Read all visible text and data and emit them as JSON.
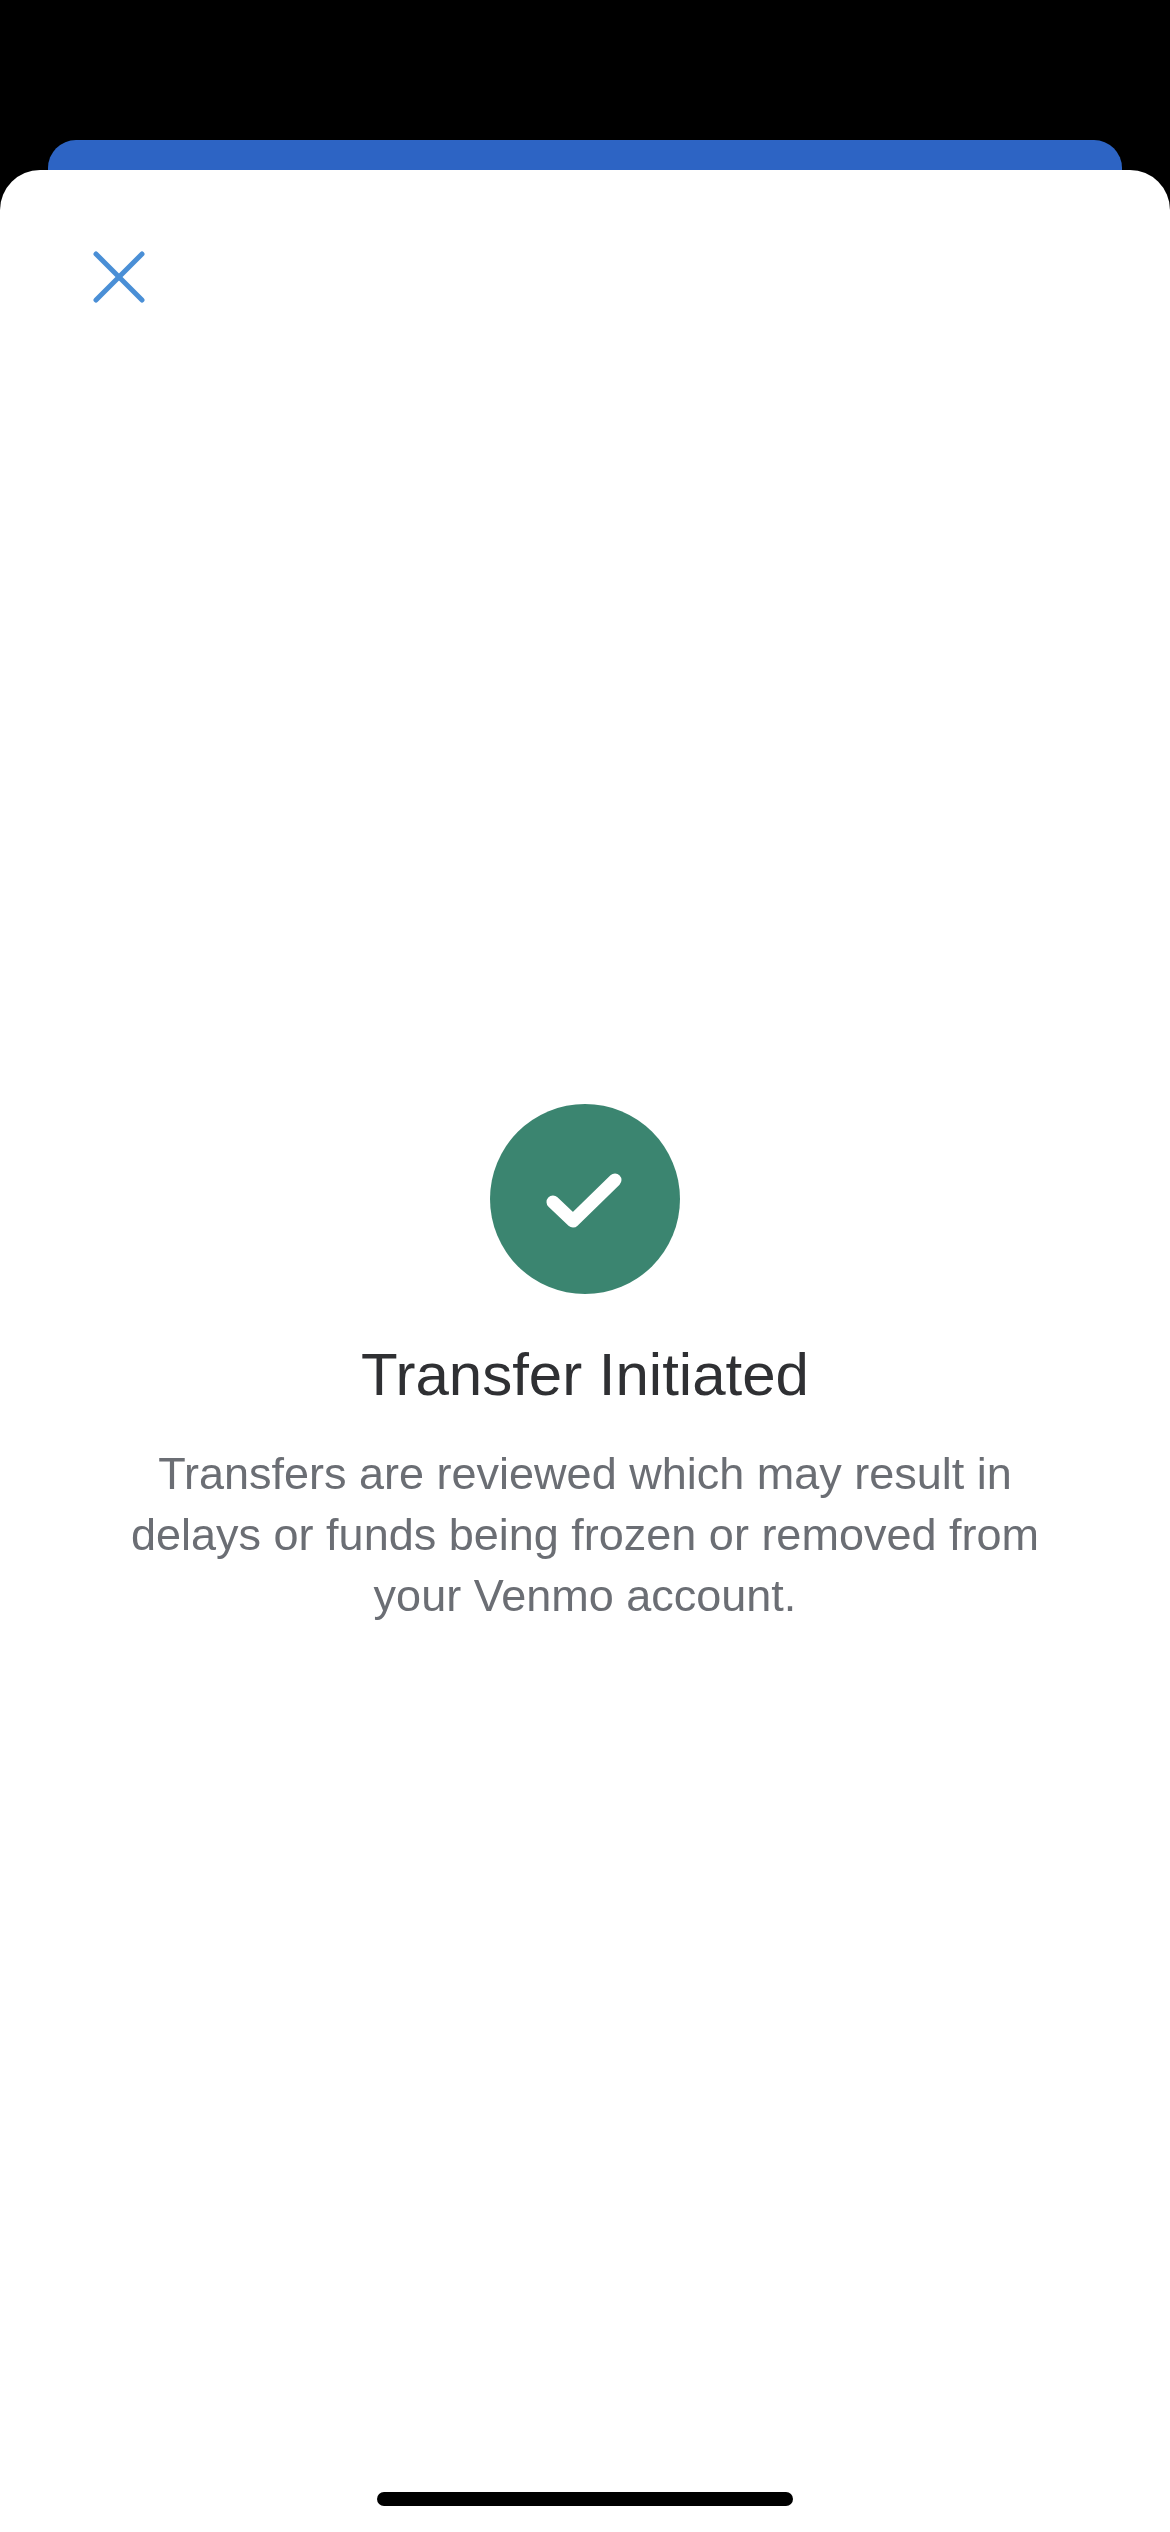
{
  "title": "Transfer Initiated",
  "message": "Transfers are reviewed which may result in delays or funds being frozen or removed from your Venmo account."
}
